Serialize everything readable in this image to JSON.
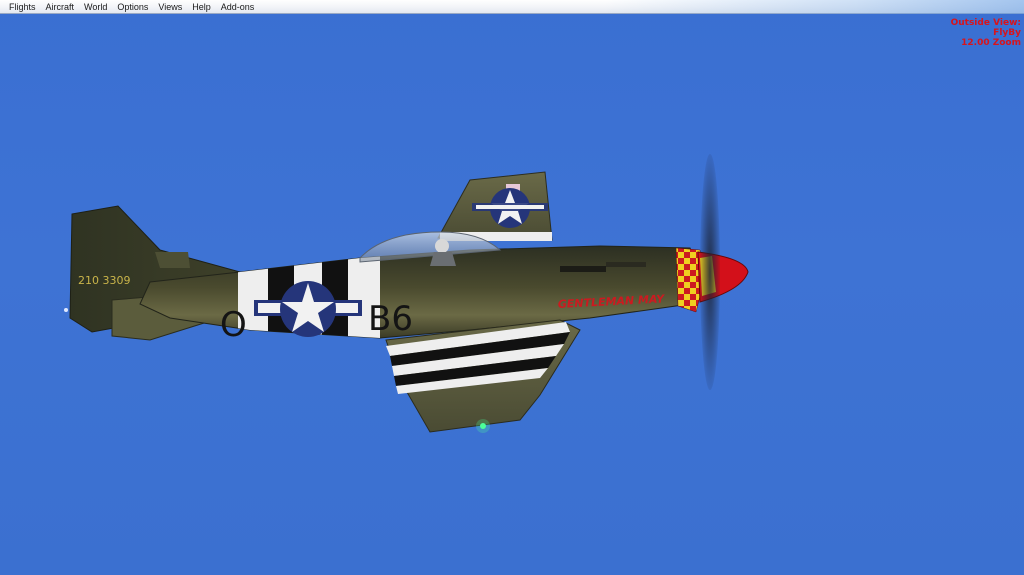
{
  "menu": {
    "items": [
      {
        "label": "Flights"
      },
      {
        "label": "Aircraft"
      },
      {
        "label": "World"
      },
      {
        "label": "Options"
      },
      {
        "label": "Views"
      },
      {
        "label": "Help"
      },
      {
        "label": "Add-ons"
      }
    ]
  },
  "view_info": {
    "view": "Outside View:",
    "mode": "FlyBy",
    "zoom": "12.00 Zoom"
  },
  "aircraft": {
    "tail_serial": "210 3309",
    "fuselage_code_left": "O",
    "fuselage_code_right": "B6",
    "nose_name": "GENTLEMAN MAY",
    "colors": {
      "sky": "#3e73d4",
      "olive_drab": "#3f4128",
      "invasion_white": "#eeeeee",
      "invasion_black": "#111111",
      "insignia_blue": "#25357a",
      "spinner_red": "#d3101a",
      "checker_yellow": "#f0d020"
    }
  }
}
